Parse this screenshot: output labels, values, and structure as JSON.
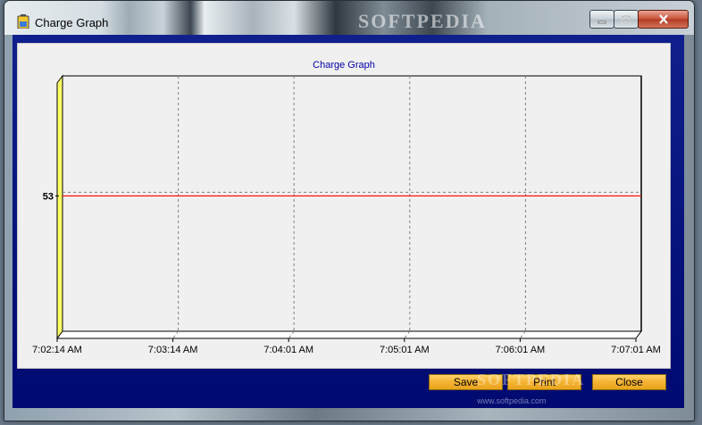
{
  "window": {
    "title": "Charge Graph",
    "watermark": "SOFTPEDIA"
  },
  "chart_data": {
    "type": "line",
    "title": "Charge Graph",
    "x_ticks": [
      "7:02:14 AM",
      "7:03:14 AM",
      "7:04:01 AM",
      "7:05:01 AM",
      "7:06:01 AM",
      "7:07:01 AM"
    ],
    "y_ticks": [
      "53"
    ],
    "series": [
      {
        "values": [
          53,
          53,
          53,
          53,
          53,
          53
        ],
        "color": "#ff0000"
      }
    ],
    "grid": true,
    "ylim": [
      0,
      100
    ]
  },
  "buttons": {
    "save": "Save",
    "print": "Print",
    "close": "Close"
  },
  "watermark_bottom": "SOFTPEDIA",
  "watermark_url": "www.softpedia.com",
  "colors": {
    "client_bg": "#000a70",
    "button_bg": "#f4b332",
    "series": "#ff0000",
    "title": "#0000aa"
  }
}
